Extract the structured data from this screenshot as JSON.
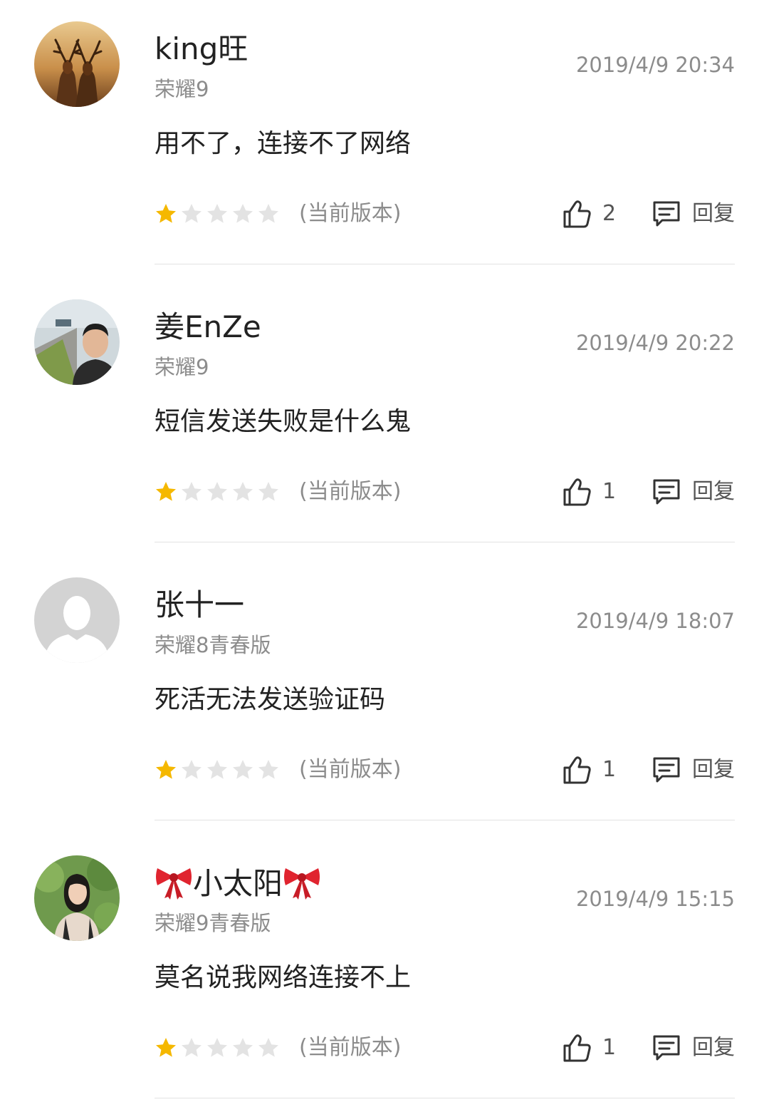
{
  "reviews": [
    {
      "username": "king旺",
      "device": "荣耀9",
      "timestamp": "2019/4/9 20:34",
      "content": "用不了，连接不了网络",
      "rating": 1,
      "max_rating": 5,
      "version_tag": "(当前版本)",
      "likes": "2",
      "reply_label": "回复",
      "avatar": "deer-avatar"
    },
    {
      "username": "姜EnZe",
      "device": "荣耀9",
      "timestamp": "2019/4/9 20:22",
      "content": "短信发送失败是什么鬼",
      "rating": 1,
      "max_rating": 5,
      "version_tag": "(当前版本)",
      "likes": "1",
      "reply_label": "回复",
      "avatar": "person-photo-avatar"
    },
    {
      "username": "张十一",
      "device": "荣耀8青春版",
      "timestamp": "2019/4/9 18:07",
      "content": "死活无法发送验证码",
      "rating": 1,
      "max_rating": 5,
      "version_tag": "(当前版本)",
      "likes": "1",
      "reply_label": "回复",
      "avatar": "default-avatar"
    },
    {
      "username": "小太阳",
      "device": "荣耀9青春版",
      "timestamp": "2019/4/9 15:15",
      "content": "莫名说我网络连接不上",
      "rating": 1,
      "max_rating": 5,
      "version_tag": "(当前版本)",
      "likes": "1",
      "reply_label": "回复",
      "avatar": "girl-photo-avatar"
    }
  ],
  "colors": {
    "star_filled": "#f5b800",
    "star_empty": "#e3e3e3",
    "text_primary": "#222222",
    "text_secondary": "#8c8c8c",
    "icon": "#333333",
    "divider": "#e2e2e2",
    "bow": "#e0242f"
  }
}
